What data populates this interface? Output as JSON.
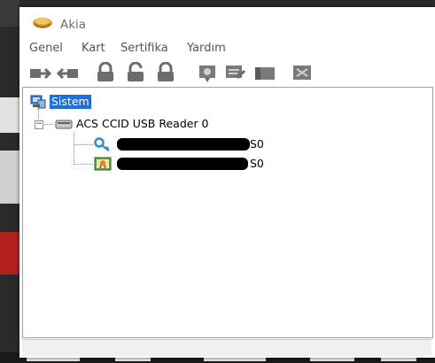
{
  "window": {
    "title": "Akia",
    "app_icon": "akia-logo-icon"
  },
  "menu": [
    "Genel",
    "Kart",
    "Sertifika",
    "Yardım"
  ],
  "toolbar": {
    "buttons": [
      "connect-reader-icon",
      "disconnect-reader-icon",
      "lock-icon",
      "unlock-icon",
      "lock-icon",
      "certificate-import-icon",
      "certificate-export-icon",
      "card-icon",
      "close-card-icon"
    ]
  },
  "tree": {
    "root": {
      "label": "Sistem",
      "icon": "computer-icon",
      "selected": true
    },
    "reader": {
      "label": "ACS CCID USB Reader 0",
      "icon": "card-reader-icon",
      "expanded": true
    },
    "children": [
      {
        "label_suffix": "S0",
        "icon": "key-icon",
        "redacted": true
      },
      {
        "label_suffix": "S0",
        "icon": "certificate-icon",
        "redacted": true
      }
    ]
  },
  "colors": {
    "selection": "#1e6fd9",
    "window_bg": "#ffffff",
    "toolbar_icon": "#6c6c6c"
  }
}
